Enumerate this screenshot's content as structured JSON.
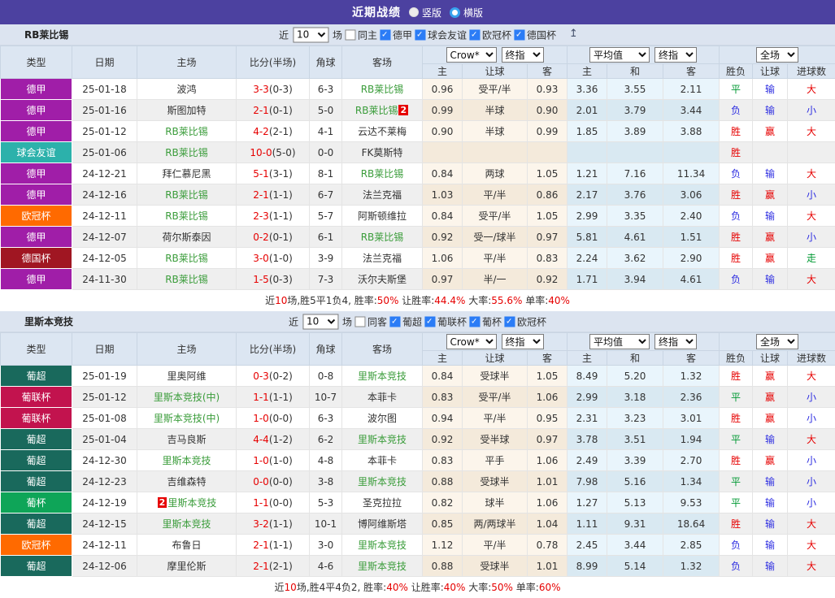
{
  "topbar": {
    "title": "近期战绩",
    "radio_vertical": "竖版",
    "radio_horizontal": "横版"
  },
  "icons": {
    "scroll_top": "↥"
  },
  "columns": {
    "type": "类型",
    "date": "日期",
    "home": "主场",
    "score": "比分(半场)",
    "corner": "角球",
    "away": "客场",
    "sub": [
      "主",
      "让球",
      "客",
      "主",
      "和",
      "客",
      "胜负",
      "让球",
      "进球数"
    ]
  },
  "legend_colors": {
    "win_red": "#E60000",
    "loss_blue": "#2D2DE1",
    "draw_green": "#009933",
    "team_green": "#3A9C3A"
  },
  "league_colors": {
    "德甲": "#A01EA8",
    "球会友谊": "#2CB1AB",
    "欧冠杯": "#FF6A00",
    "德国杯": "#A01622",
    "葡超": "#19695C",
    "葡联杯": "#C2134E",
    "葡杯": "#0EA558"
  },
  "sections": [
    {
      "team": "RB莱比锡",
      "anchor": true,
      "filter": {
        "near": "近",
        "count": "10",
        "games": "场",
        "same": "同主",
        "leagues": [
          "德甲",
          "球会友谊",
          "欧冠杯",
          "德国杯"
        ]
      },
      "selects": {
        "odds_company": "Crow*",
        "odds_final": "终指",
        "avg": "平均值",
        "avg_final": "终指",
        "scope": "全场"
      },
      "rows": [
        {
          "league": "德甲",
          "date": "25-01-18",
          "home": {
            "name": "波鸿"
          },
          "score": "3-3",
          "half": "(0-3)",
          "corner": "6-3",
          "away": {
            "name": "RB莱比锡",
            "green": true
          },
          "odds": [
            "0.96",
            "受平/半",
            "0.93"
          ],
          "avg": [
            "3.36",
            "3.55",
            "2.11"
          ],
          "res": [
            {
              "t": "平",
              "c": "g"
            },
            {
              "t": "输",
              "c": "b"
            },
            {
              "t": "大",
              "c": "r"
            }
          ]
        },
        {
          "league": "德甲",
          "date": "25-01-16",
          "home": {
            "name": "斯图加特"
          },
          "score": "2-1",
          "half": "(0-1)",
          "corner": "5-0",
          "away": {
            "name": "RB莱比锡",
            "green": true,
            "badge": "2",
            "badge_pos": "after"
          },
          "odds": [
            "0.99",
            "半球",
            "0.90"
          ],
          "avg": [
            "2.01",
            "3.79",
            "3.44"
          ],
          "res": [
            {
              "t": "负",
              "c": "b"
            },
            {
              "t": "输",
              "c": "b"
            },
            {
              "t": "小",
              "c": "b"
            }
          ]
        },
        {
          "league": "德甲",
          "date": "25-01-12",
          "home": {
            "name": "RB莱比锡",
            "green": true
          },
          "score": "4-2",
          "half": "(2-1)",
          "corner": "4-1",
          "away": {
            "name": "云达不莱梅"
          },
          "odds": [
            "0.90",
            "半球",
            "0.99"
          ],
          "avg": [
            "1.85",
            "3.89",
            "3.88"
          ],
          "res": [
            {
              "t": "胜",
              "c": "r"
            },
            {
              "t": "赢",
              "c": "r"
            },
            {
              "t": "大",
              "c": "r"
            }
          ]
        },
        {
          "league": "球会友谊",
          "date": "25-01-06",
          "home": {
            "name": "RB莱比锡",
            "green": true
          },
          "score": "10-0",
          "half": "(5-0)",
          "corner": "0-0",
          "away": {
            "name": "FK莫斯特"
          },
          "odds": [
            "",
            "",
            ""
          ],
          "avg": [
            "",
            "",
            ""
          ],
          "res": [
            {
              "t": "胜",
              "c": "r"
            },
            {
              "t": "",
              "c": ""
            },
            {
              "t": "",
              "c": ""
            }
          ]
        },
        {
          "league": "德甲",
          "date": "24-12-21",
          "home": {
            "name": "拜仁慕尼黑"
          },
          "score": "5-1",
          "half": "(3-1)",
          "corner": "8-1",
          "away": {
            "name": "RB莱比锡",
            "green": true
          },
          "odds": [
            "0.84",
            "两球",
            "1.05"
          ],
          "avg": [
            "1.21",
            "7.16",
            "11.34"
          ],
          "res": [
            {
              "t": "负",
              "c": "b"
            },
            {
              "t": "输",
              "c": "b"
            },
            {
              "t": "大",
              "c": "r"
            }
          ]
        },
        {
          "league": "德甲",
          "date": "24-12-16",
          "home": {
            "name": "RB莱比锡",
            "green": true
          },
          "score": "2-1",
          "half": "(1-1)",
          "corner": "6-7",
          "away": {
            "name": "法兰克福"
          },
          "odds": [
            "1.03",
            "平/半",
            "0.86"
          ],
          "avg": [
            "2.17",
            "3.76",
            "3.06"
          ],
          "res": [
            {
              "t": "胜",
              "c": "r"
            },
            {
              "t": "赢",
              "c": "r"
            },
            {
              "t": "小",
              "c": "b"
            }
          ]
        },
        {
          "league": "欧冠杯",
          "date": "24-12-11",
          "home": {
            "name": "RB莱比锡",
            "green": true
          },
          "score": "2-3",
          "half": "(1-1)",
          "corner": "5-7",
          "away": {
            "name": "阿斯顿维拉"
          },
          "odds": [
            "0.84",
            "受平/半",
            "1.05"
          ],
          "avg": [
            "2.99",
            "3.35",
            "2.40"
          ],
          "res": [
            {
              "t": "负",
              "c": "b"
            },
            {
              "t": "输",
              "c": "b"
            },
            {
              "t": "大",
              "c": "r"
            }
          ]
        },
        {
          "league": "德甲",
          "date": "24-12-07",
          "home": {
            "name": "荷尔斯泰因"
          },
          "score": "0-2",
          "half": "(0-1)",
          "corner": "6-1",
          "away": {
            "name": "RB莱比锡",
            "green": true
          },
          "odds": [
            "0.92",
            "受一/球半",
            "0.97"
          ],
          "avg": [
            "5.81",
            "4.61",
            "1.51"
          ],
          "res": [
            {
              "t": "胜",
              "c": "r"
            },
            {
              "t": "赢",
              "c": "r"
            },
            {
              "t": "小",
              "c": "b"
            }
          ]
        },
        {
          "league": "德国杯",
          "date": "24-12-05",
          "home": {
            "name": "RB莱比锡",
            "green": true
          },
          "score": "3-0",
          "half": "(1-0)",
          "corner": "3-9",
          "away": {
            "name": "法兰克福"
          },
          "odds": [
            "1.06",
            "平/半",
            "0.83"
          ],
          "avg": [
            "2.24",
            "3.62",
            "2.90"
          ],
          "res": [
            {
              "t": "胜",
              "c": "r"
            },
            {
              "t": "赢",
              "c": "r"
            },
            {
              "t": "走",
              "c": "g"
            }
          ]
        },
        {
          "league": "德甲",
          "date": "24-11-30",
          "home": {
            "name": "RB莱比锡",
            "green": true
          },
          "score": "1-5",
          "half": "(0-3)",
          "corner": "7-3",
          "away": {
            "name": "沃尔夫斯堡"
          },
          "odds": [
            "0.97",
            "半/一",
            "0.92"
          ],
          "avg": [
            "1.71",
            "3.94",
            "4.61"
          ],
          "res": [
            {
              "t": "负",
              "c": "b"
            },
            {
              "t": "输",
              "c": "b"
            },
            {
              "t": "大",
              "c": "r"
            }
          ]
        }
      ],
      "summary": [
        {
          "t": "近"
        },
        {
          "t": "10",
          "red": true
        },
        {
          "t": "场,胜5平1负4, 胜率:"
        },
        {
          "t": "50%",
          "red": true
        },
        {
          "t": " 让胜率:"
        },
        {
          "t": "44.4%",
          "red": true
        },
        {
          "t": " 大率:"
        },
        {
          "t": "55.6%",
          "red": true
        },
        {
          "t": " 单率:"
        },
        {
          "t": "40%",
          "red": true
        }
      ]
    },
    {
      "team": "里斯本竞技",
      "anchor": false,
      "filter": {
        "near": "近",
        "count": "10",
        "games": "场",
        "same": "同客",
        "leagues": [
          "葡超",
          "葡联杯",
          "葡杯",
          "欧冠杯"
        ]
      },
      "selects": {
        "odds_company": "Crow*",
        "odds_final": "终指",
        "avg": "平均值",
        "avg_final": "终指",
        "scope": "全场"
      },
      "rows": [
        {
          "league": "葡超",
          "date": "25-01-19",
          "home": {
            "name": "里奥阿维"
          },
          "score": "0-3",
          "half": "(0-2)",
          "corner": "0-8",
          "away": {
            "name": "里斯本竞技",
            "green": true
          },
          "odds": [
            "0.84",
            "受球半",
            "1.05"
          ],
          "avg": [
            "8.49",
            "5.20",
            "1.32"
          ],
          "res": [
            {
              "t": "胜",
              "c": "r"
            },
            {
              "t": "赢",
              "c": "r"
            },
            {
              "t": "大",
              "c": "r"
            }
          ]
        },
        {
          "league": "葡联杯",
          "date": "25-01-12",
          "home": {
            "name": "里斯本竞技(中)",
            "green": true
          },
          "score": "1-1",
          "half": "(1-1)",
          "corner": "10-7",
          "away": {
            "name": "本菲卡"
          },
          "odds": [
            "0.83",
            "受平/半",
            "1.06"
          ],
          "avg": [
            "2.99",
            "3.18",
            "2.36"
          ],
          "res": [
            {
              "t": "平",
              "c": "g"
            },
            {
              "t": "赢",
              "c": "r"
            },
            {
              "t": "小",
              "c": "b"
            }
          ]
        },
        {
          "league": "葡联杯",
          "date": "25-01-08",
          "home": {
            "name": "里斯本竞技(中)",
            "green": true
          },
          "score": "1-0",
          "half": "(0-0)",
          "corner": "6-3",
          "away": {
            "name": "波尔图"
          },
          "odds": [
            "0.94",
            "平/半",
            "0.95"
          ],
          "avg": [
            "2.31",
            "3.23",
            "3.01"
          ],
          "res": [
            {
              "t": "胜",
              "c": "r"
            },
            {
              "t": "赢",
              "c": "r"
            },
            {
              "t": "小",
              "c": "b"
            }
          ]
        },
        {
          "league": "葡超",
          "date": "25-01-04",
          "home": {
            "name": "吉马良斯"
          },
          "score": "4-4",
          "half": "(1-2)",
          "corner": "6-2",
          "away": {
            "name": "里斯本竞技",
            "green": true
          },
          "odds": [
            "0.92",
            "受半球",
            "0.97"
          ],
          "avg": [
            "3.78",
            "3.51",
            "1.94"
          ],
          "res": [
            {
              "t": "平",
              "c": "g"
            },
            {
              "t": "输",
              "c": "b"
            },
            {
              "t": "大",
              "c": "r"
            }
          ]
        },
        {
          "league": "葡超",
          "date": "24-12-30",
          "home": {
            "name": "里斯本竞技",
            "green": true
          },
          "score": "1-0",
          "half": "(1-0)",
          "corner": "4-8",
          "away": {
            "name": "本菲卡"
          },
          "odds": [
            "0.83",
            "平手",
            "1.06"
          ],
          "avg": [
            "2.49",
            "3.39",
            "2.70"
          ],
          "res": [
            {
              "t": "胜",
              "c": "r"
            },
            {
              "t": "赢",
              "c": "r"
            },
            {
              "t": "小",
              "c": "b"
            }
          ]
        },
        {
          "league": "葡超",
          "date": "24-12-23",
          "home": {
            "name": "吉维森特"
          },
          "score": "0-0",
          "half": "(0-0)",
          "corner": "3-8",
          "away": {
            "name": "里斯本竞技",
            "green": true
          },
          "odds": [
            "0.88",
            "受球半",
            "1.01"
          ],
          "avg": [
            "7.98",
            "5.16",
            "1.34"
          ],
          "res": [
            {
              "t": "平",
              "c": "g"
            },
            {
              "t": "输",
              "c": "b"
            },
            {
              "t": "小",
              "c": "b"
            }
          ]
        },
        {
          "league": "葡杯",
          "date": "24-12-19",
          "home": {
            "name": "里斯本竞技",
            "green": true,
            "badge": "2",
            "badge_pos": "before"
          },
          "score": "1-1",
          "half": "(0-0)",
          "corner": "5-3",
          "away": {
            "name": "圣克拉拉"
          },
          "odds": [
            "0.82",
            "球半",
            "1.06"
          ],
          "avg": [
            "1.27",
            "5.13",
            "9.53"
          ],
          "res": [
            {
              "t": "平",
              "c": "g"
            },
            {
              "t": "输",
              "c": "b"
            },
            {
              "t": "小",
              "c": "b"
            }
          ]
        },
        {
          "league": "葡超",
          "date": "24-12-15",
          "home": {
            "name": "里斯本竞技",
            "green": true
          },
          "score": "3-2",
          "half": "(1-1)",
          "corner": "10-1",
          "away": {
            "name": "博阿维斯塔"
          },
          "odds": [
            "0.85",
            "两/两球半",
            "1.04"
          ],
          "avg": [
            "1.11",
            "9.31",
            "18.64"
          ],
          "res": [
            {
              "t": "胜",
              "c": "r"
            },
            {
              "t": "输",
              "c": "b"
            },
            {
              "t": "大",
              "c": "r"
            }
          ]
        },
        {
          "league": "欧冠杯",
          "date": "24-12-11",
          "home": {
            "name": "布鲁日"
          },
          "score": "2-1",
          "half": "(1-1)",
          "corner": "3-0",
          "away": {
            "name": "里斯本竞技",
            "green": true
          },
          "odds": [
            "1.12",
            "平/半",
            "0.78"
          ],
          "avg": [
            "2.45",
            "3.44",
            "2.85"
          ],
          "res": [
            {
              "t": "负",
              "c": "b"
            },
            {
              "t": "输",
              "c": "b"
            },
            {
              "t": "大",
              "c": "r"
            }
          ]
        },
        {
          "league": "葡超",
          "date": "24-12-06",
          "home": {
            "name": "摩里伦斯"
          },
          "score": "2-1",
          "half": "(2-1)",
          "corner": "4-6",
          "away": {
            "name": "里斯本竞技",
            "green": true
          },
          "odds": [
            "0.88",
            "受球半",
            "1.01"
          ],
          "avg": [
            "8.99",
            "5.14",
            "1.32"
          ],
          "res": [
            {
              "t": "负",
              "c": "b"
            },
            {
              "t": "输",
              "c": "b"
            },
            {
              "t": "大",
              "c": "r"
            }
          ]
        }
      ],
      "summary": [
        {
          "t": "近"
        },
        {
          "t": "10",
          "red": true
        },
        {
          "t": "场,胜4平4负2, 胜率:"
        },
        {
          "t": "40%",
          "red": true
        },
        {
          "t": " 让胜率:"
        },
        {
          "t": "40%",
          "red": true
        },
        {
          "t": " 大率:"
        },
        {
          "t": "50%",
          "red": true
        },
        {
          "t": " 单率:"
        },
        {
          "t": "60%",
          "red": true
        }
      ]
    }
  ]
}
